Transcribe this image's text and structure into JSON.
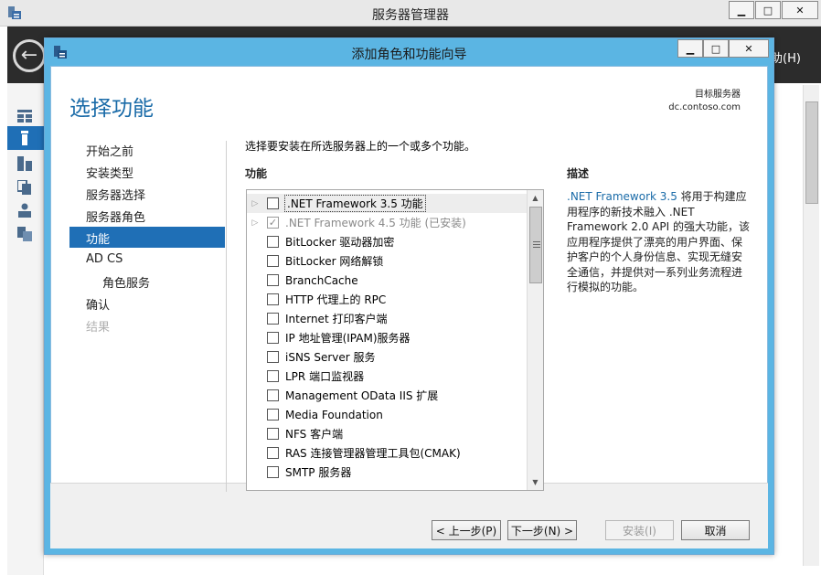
{
  "outer_window": {
    "title": "服务器管理器",
    "minimize": "▁",
    "maximize": "□",
    "close": "✕",
    "help_menu": "助(H)"
  },
  "wizard": {
    "title": "添加角色和功能向导",
    "minimize": "▁",
    "maximize": "□",
    "close": "✕",
    "page_heading": "选择功能",
    "destination_label": "目标服务器",
    "destination_server": "dc.contoso.com",
    "nav": [
      {
        "label": "开始之前",
        "state": "normal"
      },
      {
        "label": "安装类型",
        "state": "normal"
      },
      {
        "label": "服务器选择",
        "state": "normal"
      },
      {
        "label": "服务器角色",
        "state": "normal"
      },
      {
        "label": "功能",
        "state": "selected"
      },
      {
        "label": "AD CS",
        "state": "normal"
      },
      {
        "label": "角色服务",
        "state": "normal"
      },
      {
        "label": "确认",
        "state": "normal"
      },
      {
        "label": "结果",
        "state": "disabled"
      }
    ],
    "intro_text": "选择要安装在所选服务器上的一个或多个功能。",
    "features_header": "功能",
    "features": [
      {
        "label": ".NET Framework 3.5 功能",
        "expandable": true,
        "checked": false,
        "highlighted": true,
        "disabled": false
      },
      {
        "label": ".NET Framework 4.5 功能 (已安装)",
        "expandable": true,
        "checked": true,
        "highlighted": false,
        "disabled": true
      },
      {
        "label": "BitLocker 驱动器加密",
        "expandable": false,
        "checked": false,
        "highlighted": false,
        "disabled": false
      },
      {
        "label": "BitLocker 网络解锁",
        "expandable": false,
        "checked": false,
        "highlighted": false,
        "disabled": false
      },
      {
        "label": "BranchCache",
        "expandable": false,
        "checked": false,
        "highlighted": false,
        "disabled": false
      },
      {
        "label": "HTTP 代理上的 RPC",
        "expandable": false,
        "checked": false,
        "highlighted": false,
        "disabled": false
      },
      {
        "label": "Internet 打印客户端",
        "expandable": false,
        "checked": false,
        "highlighted": false,
        "disabled": false
      },
      {
        "label": "IP 地址管理(IPAM)服务器",
        "expandable": false,
        "checked": false,
        "highlighted": false,
        "disabled": false
      },
      {
        "label": "iSNS Server 服务",
        "expandable": false,
        "checked": false,
        "highlighted": false,
        "disabled": false
      },
      {
        "label": "LPR 端口监视器",
        "expandable": false,
        "checked": false,
        "highlighted": false,
        "disabled": false
      },
      {
        "label": "Management OData IIS 扩展",
        "expandable": false,
        "checked": false,
        "highlighted": false,
        "disabled": false
      },
      {
        "label": "Media Foundation",
        "expandable": false,
        "checked": false,
        "highlighted": false,
        "disabled": false
      },
      {
        "label": "NFS 客户端",
        "expandable": false,
        "checked": false,
        "highlighted": false,
        "disabled": false
      },
      {
        "label": "RAS 连接管理器管理工具包(CMAK)",
        "expandable": false,
        "checked": false,
        "highlighted": false,
        "disabled": false
      },
      {
        "label": "SMTP 服务器",
        "expandable": false,
        "checked": false,
        "highlighted": false,
        "disabled": false
      }
    ],
    "description_header": "描述",
    "description_link": ".NET Framework 3.5",
    "description_text": " 将用于构建应用程序的新技术融入 .NET Framework 2.0 API 的强大功能，该应用程序提供了漂亮的用户界面、保护客户的个人身份信息、实现无缝安全通信，并提供对一系列业务流程进行模拟的功能。",
    "buttons": {
      "previous": "< 上一步(P)",
      "next": "下一步(N) >",
      "install": "安装(I)",
      "cancel": "取消"
    }
  },
  "colors": {
    "dialog_frame": "#5bb5e3",
    "accent_blue": "#1f6fb6",
    "heading_blue": "#1a6ba8"
  }
}
